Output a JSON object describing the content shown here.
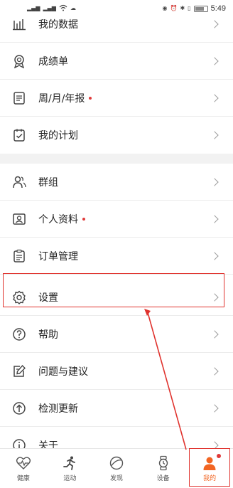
{
  "status_bar": {
    "time": "5:49",
    "left_icons": [
      "signal-icon",
      "signal-icon",
      "wifi-icon",
      "cloud-icon"
    ],
    "right_icons": [
      "eye-icon",
      "alarm-icon",
      "bluetooth-icon",
      "vibrate-icon",
      "battery-icon"
    ]
  },
  "menu": {
    "group1": [
      {
        "label": "我的数据",
        "icon": "bar-chart-icon",
        "dot": false
      },
      {
        "label": "成绩单",
        "icon": "medal-icon",
        "dot": false
      },
      {
        "label": "周/月/年报",
        "icon": "report-icon",
        "dot": true
      },
      {
        "label": "我的计划",
        "icon": "plan-icon",
        "dot": false
      }
    ],
    "group2": [
      {
        "label": "群组",
        "icon": "group-icon",
        "dot": false
      },
      {
        "label": "个人资料",
        "icon": "profile-icon",
        "dot": true
      },
      {
        "label": "订单管理",
        "icon": "order-icon",
        "dot": false
      },
      {
        "label": "设置",
        "icon": "gear-icon",
        "dot": false
      },
      {
        "label": "帮助",
        "icon": "help-icon",
        "dot": false
      },
      {
        "label": "问题与建议",
        "icon": "feedback-icon",
        "dot": false
      },
      {
        "label": "检测更新",
        "icon": "update-icon",
        "dot": false
      },
      {
        "label": "关于",
        "icon": "info-icon",
        "dot": false
      }
    ]
  },
  "tabbar": {
    "tabs": [
      {
        "label": "健康",
        "icon": "heart-pulse-icon",
        "active": false
      },
      {
        "label": "运动",
        "icon": "runner-icon",
        "active": false
      },
      {
        "label": "发现",
        "icon": "discover-icon",
        "active": false
      },
      {
        "label": "设备",
        "icon": "watch-icon",
        "active": false
      },
      {
        "label": "我的",
        "icon": "person-icon",
        "active": true
      }
    ]
  },
  "colors": {
    "accent": "#f26522",
    "annotation": "#e0332e",
    "dot": "#e03a3a"
  }
}
